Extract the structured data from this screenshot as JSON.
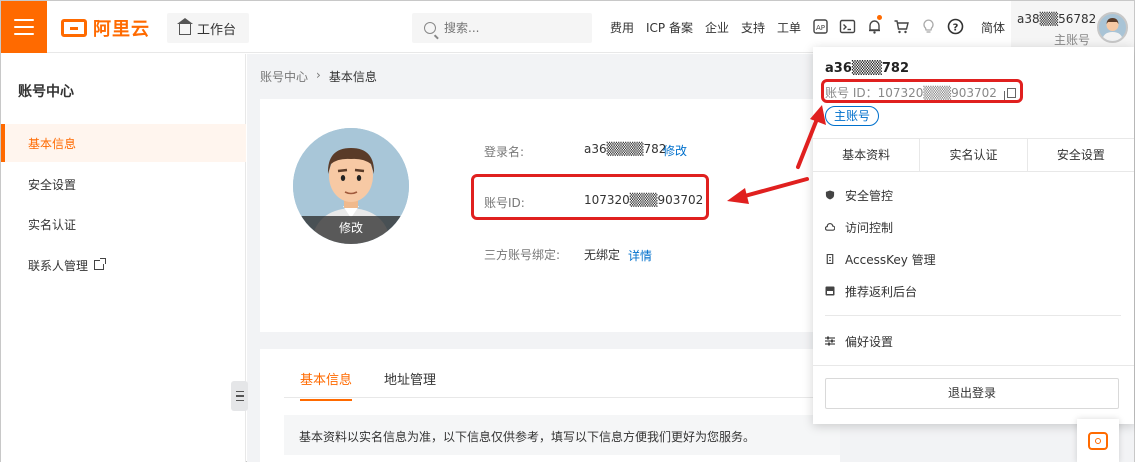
{
  "header": {
    "logo_text": "阿里云",
    "workbench_label": "工作台",
    "search_placeholder": "搜索...",
    "nav_links": [
      "费用",
      "ICP 备案",
      "企业",
      "支持",
      "工单"
    ],
    "lang": "简体",
    "user_name": "a38▒▒56782",
    "user_role": "主账号",
    "icons": [
      "api-icon",
      "terminal-icon",
      "bell-icon",
      "cart-icon",
      "bulb-icon",
      "help-icon"
    ],
    "notify_dot_color": "#ff6a00"
  },
  "sidebar": {
    "title": "账号中心",
    "items": [
      {
        "label": "基本信息",
        "active": true
      },
      {
        "label": "安全设置",
        "active": false
      },
      {
        "label": "实名认证",
        "active": false
      },
      {
        "label": "联系人管理",
        "active": false,
        "external": true
      }
    ]
  },
  "breadcrumb": {
    "root": "账号中心",
    "sep": "›",
    "current": "基本信息"
  },
  "profile": {
    "avatar_edit": "修改",
    "login_label": "登录名:",
    "login_value": "a36▒▒▒▒782",
    "login_edit": "修改",
    "id_label": "账号ID:",
    "id_value": "107320▒▒▒903702",
    "third_label": "三方账号绑定:",
    "third_value": "无绑定",
    "third_link": "详情"
  },
  "detail_tabs": {
    "tabs": [
      {
        "label": "基本信息",
        "active": true
      },
      {
        "label": "地址管理",
        "active": false
      }
    ],
    "notice": "基本资料以实名信息为准，以下信息仅供参考，填写以下信息方便我们更好为您服务。"
  },
  "panel": {
    "name": "a36▒▒▒782",
    "id_text": "账号 ID：107320▒▒▒903702",
    "badge": "主账号",
    "tabs": [
      "基本资料",
      "实名认证",
      "安全设置"
    ],
    "items": [
      {
        "label": "安全管控",
        "icon": "shield-icon"
      },
      {
        "label": "访问控制",
        "icon": "cloud-icon"
      },
      {
        "label": "AccessKey 管理",
        "icon": "key-icon"
      },
      {
        "label": "推荐返利后台",
        "icon": "gift-icon"
      }
    ],
    "pref_label": "偏好设置",
    "logout_label": "退出登录"
  },
  "colors": {
    "brand": "#ff6a00",
    "link": "#0070cc",
    "highlight": "#e0201f"
  }
}
